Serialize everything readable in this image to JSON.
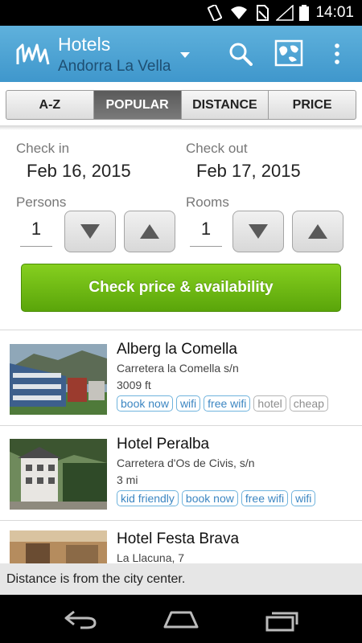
{
  "status_bar": {
    "time": "14:01",
    "icons": [
      "vibrate-icon",
      "wifi-icon",
      "no-sim-icon",
      "signal-icon",
      "battery-icon"
    ]
  },
  "action_bar": {
    "title": "Hotels",
    "city": "Andorra La Vella",
    "actions": [
      "search-icon",
      "map-icon",
      "overflow-menu-icon"
    ]
  },
  "sort_tabs": [
    {
      "label": "A-Z",
      "active": false
    },
    {
      "label": "POPULAR",
      "active": true
    },
    {
      "label": "DISTANCE",
      "active": false
    },
    {
      "label": "PRICE",
      "active": false
    }
  ],
  "booking": {
    "check_in_label": "Check in",
    "check_in_date": "Feb 16, 2015",
    "check_out_label": "Check out",
    "check_out_date": "Feb 17, 2015",
    "persons_label": "Persons",
    "persons_value": "1",
    "rooms_label": "Rooms",
    "rooms_value": "1",
    "check_button": "Check price & availability"
  },
  "hotels": [
    {
      "name": "Alberg la Comella",
      "address": "Carretera la Comella s/n",
      "distance": "3009 ft",
      "tags": [
        {
          "label": "book now",
          "style": "blue"
        },
        {
          "label": "wifi",
          "style": "blue"
        },
        {
          "label": "free wifi",
          "style": "blue"
        },
        {
          "label": "hotel",
          "style": "grey"
        },
        {
          "label": "cheap",
          "style": "grey"
        }
      ]
    },
    {
      "name": "Hotel Peralba",
      "address": "Carretera d'Os de Civis, s/n",
      "distance": "3 mi",
      "tags": [
        {
          "label": "kid friendly",
          "style": "blue"
        },
        {
          "label": "book now",
          "style": "blue"
        },
        {
          "label": "free wifi",
          "style": "blue"
        },
        {
          "label": "wifi",
          "style": "blue"
        }
      ]
    },
    {
      "name": "Hotel Festa Brava",
      "address": "La Llacuna, 7",
      "distance": "",
      "tags": []
    }
  ],
  "footer_note": "Distance is from the city center.",
  "nav_bar": [
    "back-icon",
    "home-icon",
    "recents-icon"
  ],
  "colors": {
    "action_bar": "#4ba3d4",
    "button_green": "#6fbd14",
    "tag_blue": "#3c86c2",
    "subtitle": "#1e4f73"
  }
}
